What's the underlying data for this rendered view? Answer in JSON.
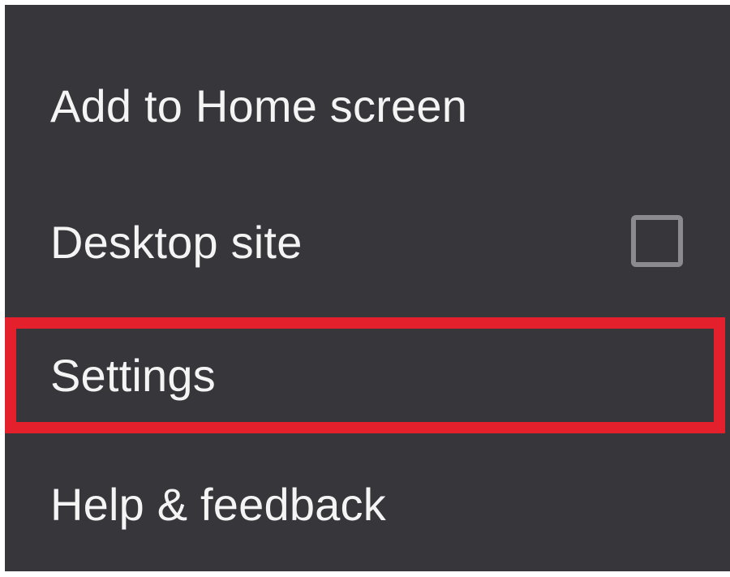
{
  "menu": {
    "items": [
      {
        "id": "add_to_home",
        "label": "Add to Home screen"
      },
      {
        "id": "desktop_site",
        "label": "Desktop site",
        "checkbox": {
          "checked": false
        }
      },
      {
        "id": "settings",
        "label": "Settings",
        "highlighted": true
      },
      {
        "id": "help",
        "label": "Help & feedback"
      }
    ]
  },
  "colors": {
    "menu_background": "#37363b",
    "text": "#f4f4f4",
    "highlight_border": "#e3202b",
    "checkbox_border": "#8b8b8f",
    "page_background": "#ffffff"
  }
}
